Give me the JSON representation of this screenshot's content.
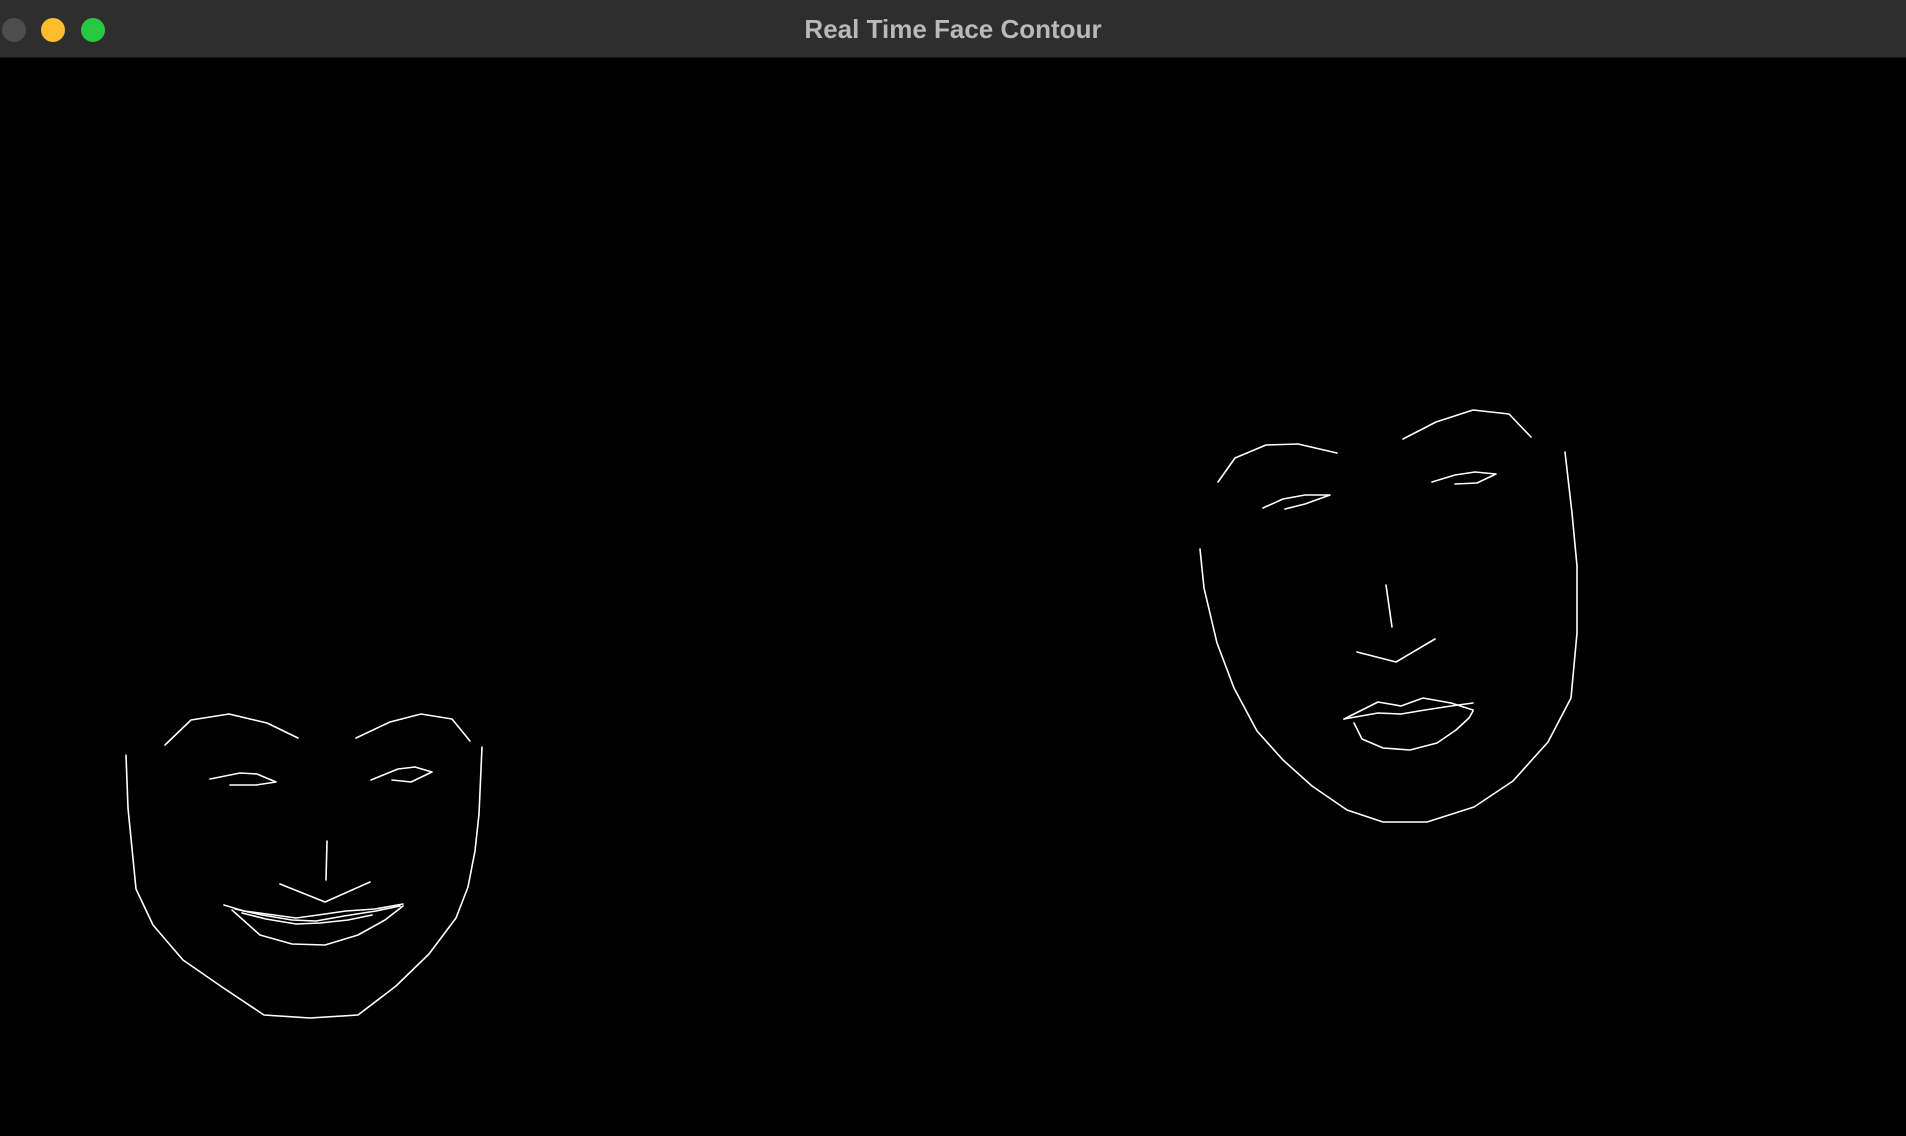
{
  "window": {
    "title": "Real Time Face Contour",
    "controls": {
      "close": "close-button",
      "minimize": "minimize-button",
      "maximize": "maximize-button"
    }
  },
  "canvas": {
    "background": "#000000",
    "stroke_color": "#ffffff"
  }
}
